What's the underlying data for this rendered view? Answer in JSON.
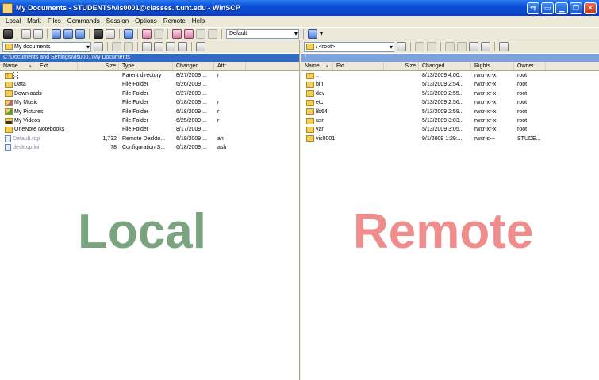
{
  "window": {
    "title": "My Documents - STUDENTS\\vis0001@classes.lt.unt.edu - WinSCP",
    "controls": [
      "⇆",
      "▭",
      "▁",
      "❐",
      "✕"
    ]
  },
  "menu": [
    "Local",
    "Mark",
    "Files",
    "Commands",
    "Session",
    "Options",
    "Remote",
    "Help"
  ],
  "toolbar": {
    "profile_combo": "Default"
  },
  "local": {
    "location_combo": "My documents",
    "path": "C:\\Documents and Settings\\vis0001\\My Documents",
    "columns": [
      "Name",
      "Ext",
      "Size",
      "Type",
      "Changed",
      "Attr"
    ],
    "rows": [
      {
        "name": "..",
        "ext": "",
        "size": "",
        "type": "Parent directory",
        "changed": "8/27/2009 ...",
        "attr": "r",
        "icon": "parent-folder-icon"
      },
      {
        "name": "Data",
        "ext": "",
        "size": "",
        "type": "File Folder",
        "changed": "6/26/2009 ...",
        "attr": "",
        "icon": "folder-icon"
      },
      {
        "name": "Downloads",
        "ext": "",
        "size": "",
        "type": "File Folder",
        "changed": "8/27/2009 ...",
        "attr": "",
        "icon": "folder-icon"
      },
      {
        "name": "My Music",
        "ext": "",
        "size": "",
        "type": "File Folder",
        "changed": "6/18/2009 ...",
        "attr": "r",
        "icon": "music-folder-icon"
      },
      {
        "name": "My Pictures",
        "ext": "",
        "size": "",
        "type": "File Folder",
        "changed": "6/18/2009 ...",
        "attr": "r",
        "icon": "pictures-folder-icon"
      },
      {
        "name": "My Videos",
        "ext": "",
        "size": "",
        "type": "File Folder",
        "changed": "6/25/2009 ...",
        "attr": "r",
        "icon": "videos-folder-icon"
      },
      {
        "name": "OneNote Notebooks",
        "ext": "",
        "size": "",
        "type": "File Folder",
        "changed": "8/17/2009 ...",
        "attr": "",
        "icon": "folder-icon"
      },
      {
        "name": "Default.rdp",
        "ext": "",
        "size": "1,732",
        "type": "Remote Deskto...",
        "changed": "6/19/2009 ...",
        "attr": "ah",
        "icon": "rdp-file-icon"
      },
      {
        "name": "desktop.ini",
        "ext": "",
        "size": "78",
        "type": "Configuration S...",
        "changed": "6/18/2009 ...",
        "attr": "ash",
        "icon": "ini-file-icon"
      }
    ],
    "watermark": "Local"
  },
  "remote": {
    "location_combo": "/ <root>",
    "path": "/",
    "columns": [
      "Name",
      "Ext",
      "Size",
      "Changed",
      "Rights",
      "Owner"
    ],
    "rows": [
      {
        "name": "..",
        "ext": "",
        "size": "",
        "changed": "8/13/2009 4:00...",
        "rights": "rwxr-xr-x",
        "owner": "root",
        "icon": "parent-folder-icon"
      },
      {
        "name": "bin",
        "ext": "",
        "size": "",
        "changed": "5/13/2009 2:54...",
        "rights": "rwxr-xr-x",
        "owner": "root",
        "icon": "folder-icon"
      },
      {
        "name": "dev",
        "ext": "",
        "size": "",
        "changed": "5/13/2009 2:55...",
        "rights": "rwxr-xr-x",
        "owner": "root",
        "icon": "folder-icon"
      },
      {
        "name": "etc",
        "ext": "",
        "size": "",
        "changed": "5/13/2009 2:56...",
        "rights": "rwxr-xr-x",
        "owner": "root",
        "icon": "folder-icon"
      },
      {
        "name": "lib64",
        "ext": "",
        "size": "",
        "changed": "5/13/2009 2:59...",
        "rights": "rwxr-xr-x",
        "owner": "root",
        "icon": "folder-icon"
      },
      {
        "name": "usr",
        "ext": "",
        "size": "",
        "changed": "5/13/2009 3:03...",
        "rights": "rwxr-xr-x",
        "owner": "root",
        "icon": "folder-icon"
      },
      {
        "name": "var",
        "ext": "",
        "size": "",
        "changed": "5/13/2009 3:05...",
        "rights": "rwxr-xr-x",
        "owner": "root",
        "icon": "folder-icon"
      },
      {
        "name": "vis0001",
        "ext": "",
        "size": "",
        "changed": "9/1/2009 1:29:...",
        "rights": "rwxr-s---",
        "owner": "STUDE...",
        "icon": "folder-icon"
      }
    ],
    "watermark": "Remote"
  },
  "colors": {
    "titlebar": "#0a4fd6",
    "active_path": "#316ac5",
    "local_watermark": "#7aa37f",
    "remote_watermark": "#ef8c8c"
  }
}
